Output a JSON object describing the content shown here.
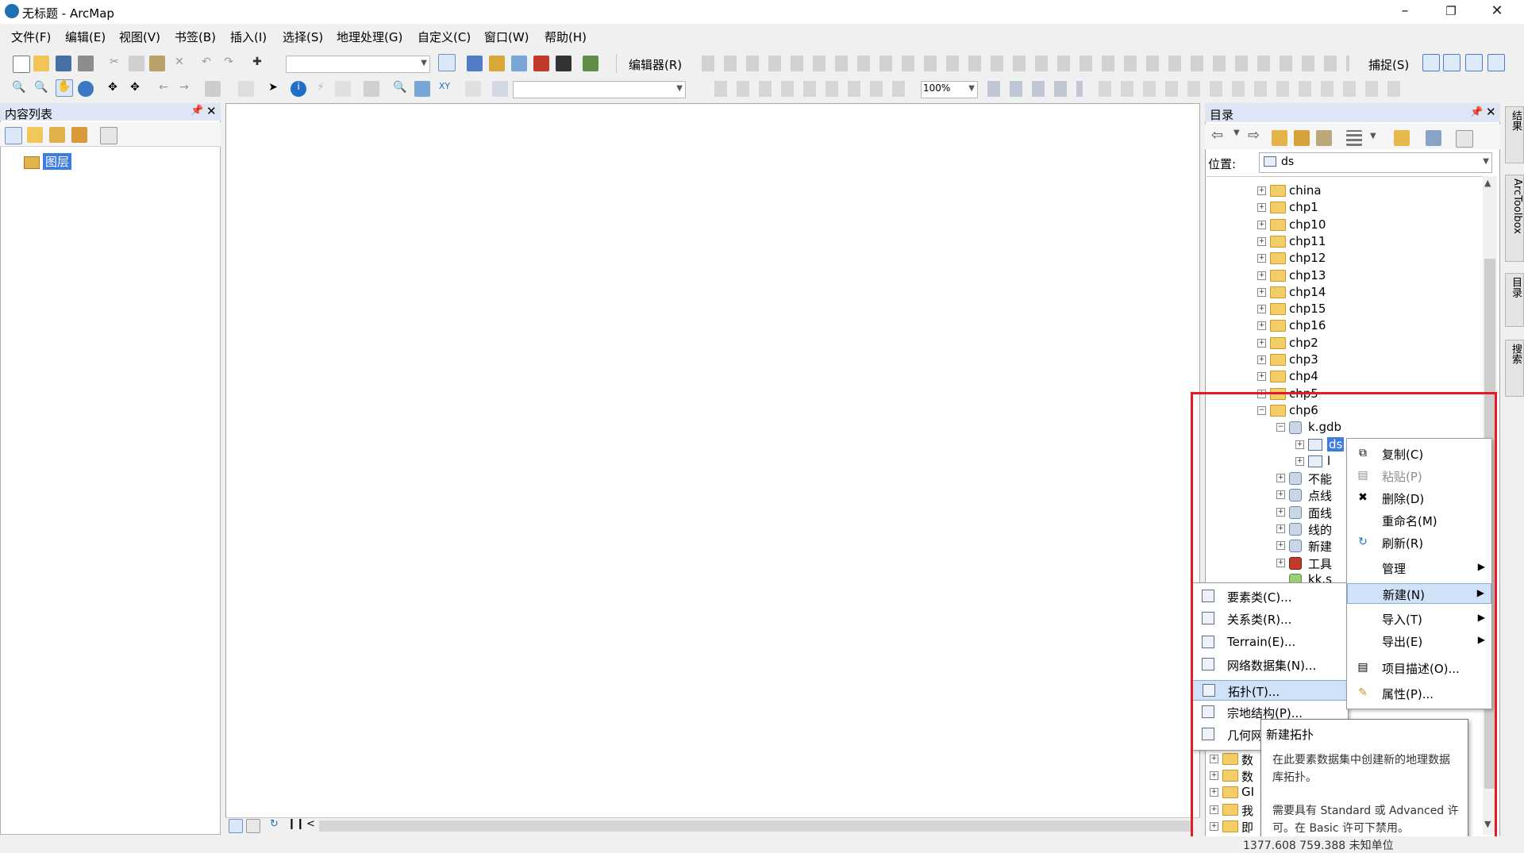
{
  "window": {
    "title": "无标题 - ArcMap",
    "controls": [
      "minimize-icon",
      "maximize-icon",
      "close-icon"
    ]
  },
  "menu": [
    "文件(F)",
    "编辑(E)",
    "视图(V)",
    "书签(B)",
    "插入(I)",
    "选择(S)",
    "地理处理(G)",
    "自定义(C)",
    "窗口(W)",
    "帮助(H)"
  ],
  "toolbar": {
    "editor_label": "编辑器(R)",
    "snapping_label": "捕捉(S)",
    "zoom_value": "100%",
    "scale_value": "",
    "layer_combo_value": ""
  },
  "toc": {
    "title": "内容列表",
    "layers_label": "图层"
  },
  "catalog": {
    "title": "目录",
    "location_label": "位置:",
    "location_value": "ds",
    "tree": [
      {
        "label": "china",
        "type": "folder"
      },
      {
        "label": "chp1",
        "type": "folder"
      },
      {
        "label": "chp10",
        "type": "folder"
      },
      {
        "label": "chp11",
        "type": "folder"
      },
      {
        "label": "chp12",
        "type": "folder"
      },
      {
        "label": "chp13",
        "type": "folder"
      },
      {
        "label": "chp14",
        "type": "folder"
      },
      {
        "label": "chp15",
        "type": "folder"
      },
      {
        "label": "chp16",
        "type": "folder"
      },
      {
        "label": "chp2",
        "type": "folder"
      },
      {
        "label": "chp3",
        "type": "folder"
      },
      {
        "label": "chp4",
        "type": "folder"
      },
      {
        "label": "chp5",
        "type": "folder"
      },
      {
        "label": "chp6",
        "type": "folder",
        "expanded": true
      },
      {
        "label": "k.gdb",
        "type": "gdb",
        "expanded": true
      },
      {
        "label": "ds",
        "type": "dataset",
        "selected": true
      },
      {
        "label": "l",
        "type": "dataset"
      },
      {
        "label": "不能",
        "type": "gdb"
      },
      {
        "label": "点线",
        "type": "gdb"
      },
      {
        "label": "面线",
        "type": "gdb"
      },
      {
        "label": "线的",
        "type": "gdb"
      },
      {
        "label": "新建",
        "type": "gdb"
      },
      {
        "label": "工具",
        "type": "toolbox"
      },
      {
        "label": "kk.s",
        "type": "file"
      },
      {
        "label": "数",
        "type": "item"
      },
      {
        "label": "数",
        "type": "item"
      },
      {
        "label": "GI",
        "type": "item"
      },
      {
        "label": "我",
        "type": "item"
      },
      {
        "label": "即",
        "type": "item"
      }
    ]
  },
  "context_menu": {
    "items": [
      {
        "label": "复制(C)",
        "icon": "copy-icon"
      },
      {
        "label": "粘贴(P)",
        "icon": "paste-icon",
        "disabled": true
      },
      {
        "label": "删除(D)",
        "icon": "delete-icon"
      },
      {
        "label": "重命名(M)",
        "icon": ""
      },
      {
        "label": "刷新(R)",
        "icon": "refresh-icon"
      },
      {
        "label": "管理",
        "submenu": true
      },
      {
        "label": "新建(N)",
        "submenu": true,
        "highlighted": true
      },
      {
        "label": "导入(T)",
        "submenu": true
      },
      {
        "label": "导出(E)",
        "submenu": true
      },
      {
        "label": "项目描述(O)...",
        "icon": "description-icon"
      },
      {
        "label": "属性(P)...",
        "icon": "properties-icon"
      }
    ]
  },
  "submenu": {
    "items": [
      {
        "label": "要素类(C)...",
        "icon": "feature-class-icon"
      },
      {
        "label": "关系类(R)...",
        "icon": "relationship-class-icon"
      },
      {
        "label": "Terrain(E)...",
        "icon": "terrain-icon"
      },
      {
        "label": "网络数据集(N)...",
        "icon": "network-dataset-icon"
      },
      {
        "label": "拓扑(T)...",
        "icon": "topology-icon",
        "highlighted": true
      },
      {
        "label": "宗地结构(P)...",
        "icon": "parcel-fabric-icon"
      },
      {
        "label": "几何网",
        "icon": "geometric-network-icon"
      }
    ]
  },
  "tooltip": {
    "title": "新建拓扑",
    "line1": "在此要素数据集中创建新的地理数据库拓扑。",
    "line2": "需要具有 Standard 或 Advanced 许可。在 Basic 许可下禁用。"
  },
  "dock_tabs": [
    "结果",
    "ArcToolbox",
    "目录",
    "搜索"
  ],
  "status": {
    "coordinates": "1377.608  759.388 未知单位"
  },
  "colors": {
    "highlight_border": "#e41b23",
    "selection": "#3e7ce0",
    "menu_highlight": "#cfe2f8"
  }
}
